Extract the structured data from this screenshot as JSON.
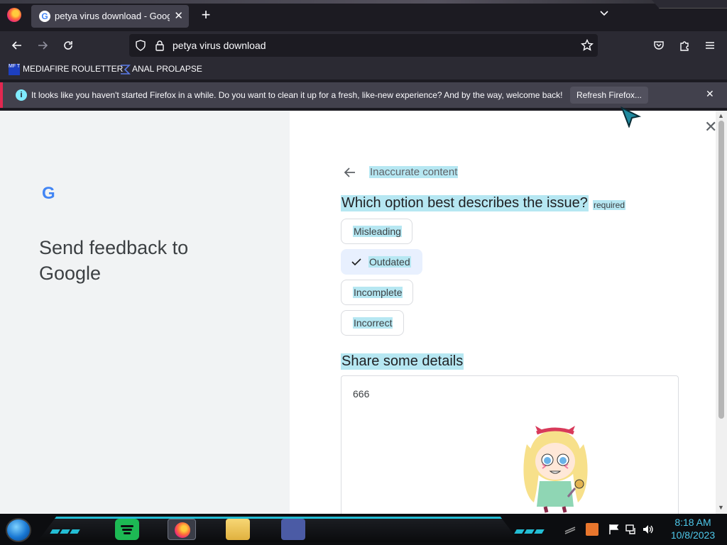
{
  "browser": {
    "tab": {
      "title": "petya virus download - Google"
    },
    "url": "petya virus download",
    "bookmarks": [
      {
        "label": "MEDIAFIRE ROULETTER",
        "icon": "mediafire-icon",
        "icon_text": "MF T"
      },
      {
        "label": "ANAL PROLAPSE",
        "icon": "sigma-icon"
      }
    ],
    "notification": {
      "message": "It looks like you haven't started Firefox in a while. Do you want to clean it up for a fresh, like-new experience? And by the way, welcome back!",
      "button": "Refresh Firefox..."
    }
  },
  "feedback": {
    "google_logo": "G",
    "title": "Send feedback to Google",
    "breadcrumb": "Inaccurate content",
    "question": "Which option best describes the issue?",
    "required": "required",
    "options": [
      {
        "label": "Misleading",
        "selected": false
      },
      {
        "label": "Outdated",
        "selected": true
      },
      {
        "label": "Incomplete",
        "selected": false
      },
      {
        "label": "Incorrect",
        "selected": false
      }
    ],
    "details_label": "Share some details",
    "details_value": "666"
  },
  "taskbar": {
    "apps": [
      "spotify",
      "firefox",
      "file-explorer",
      "window-app"
    ],
    "clock": {
      "time": "8:18 AM",
      "date": "10/8/2023"
    }
  },
  "colors": {
    "highlight": "#b6e7f2",
    "accent": "#23bdd4",
    "notif_border": "#e22850"
  }
}
